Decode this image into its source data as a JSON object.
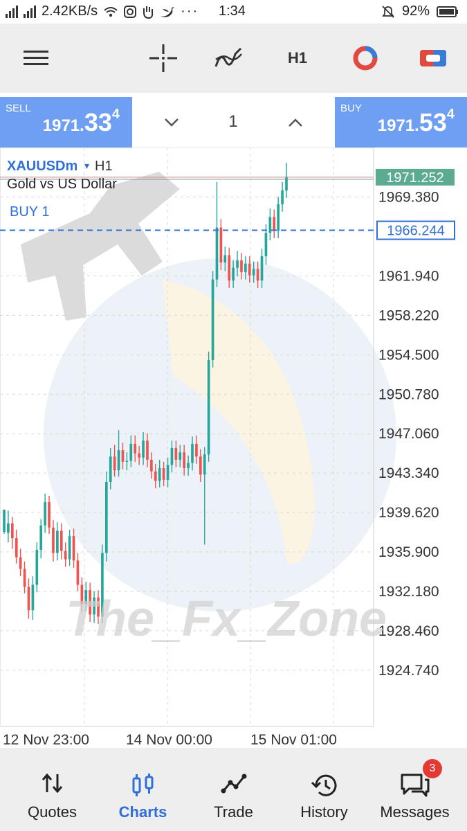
{
  "status_bar": {
    "speed": "2.42KB/s",
    "time": "1:34",
    "battery": "92%",
    "icons": [
      "signal-icon",
      "wifi-icon",
      "instagram-icon",
      "hand-icon",
      "twitter-icon",
      "more-dots-icon",
      "mute-icon",
      "battery-icon"
    ]
  },
  "toolbar": {
    "timeframe": "H1",
    "icons": [
      "menu-icon",
      "crosshair-icon",
      "indicators-icon",
      "objects-icon",
      "account-icon"
    ]
  },
  "trade_panel": {
    "sell_label": "SELL",
    "sell_price_small": "1971.",
    "sell_price_big": "33",
    "sell_price_sup": "4",
    "lot": "1",
    "buy_label": "BUY",
    "buy_price_small": "1971.",
    "buy_price_big": "53",
    "buy_price_sup": "4"
  },
  "chart": {
    "symbol": "XAUUSDm",
    "timeframe": "H1",
    "description": "Gold vs US Dollar",
    "order_label": "BUY 1",
    "current_price": "1971.252",
    "order_price": "1966.244",
    "watermark": "The_Fx_Zone",
    "colors": {
      "bull": "#26a69a",
      "bear": "#ef5350",
      "order_line": "#2f6fd6",
      "price_tag": "#26a69a"
    }
  },
  "chart_data": {
    "type": "candlestick",
    "y_ticks": [
      "1969.380",
      "1961.940",
      "1958.220",
      "1954.500",
      "1950.780",
      "1947.060",
      "1943.340",
      "1939.620",
      "1935.900",
      "1932.180",
      "1928.460",
      "1924.740"
    ],
    "x_ticks": [
      "12 Nov 23:00",
      "14 Nov 00:00",
      "15 Nov 01:00"
    ],
    "ylim": [
      1921.4,
      1973.4
    ],
    "candles": [
      [
        1937.8,
        1939.9,
        1939.0,
        1937.6
      ],
      [
        1937.7,
        1938.6,
        1939.8,
        1936.8
      ],
      [
        1938.6,
        1937.2,
        1939.2,
        1936.2
      ],
      [
        1937.2,
        1935.4,
        1938.0,
        1934.8
      ],
      [
        1935.4,
        1934.3,
        1936.2,
        1933.6
      ],
      [
        1934.3,
        1932.6,
        1935.0,
        1932.0
      ],
      [
        1932.6,
        1930.4,
        1933.4,
        1929.6
      ],
      [
        1930.4,
        1932.8,
        1933.6,
        1929.5
      ],
      [
        1932.8,
        1936.1,
        1936.8,
        1932.1
      ],
      [
        1936.1,
        1938.4,
        1939.0,
        1935.3
      ],
      [
        1938.4,
        1940.6,
        1941.4,
        1937.7
      ],
      [
        1940.6,
        1938.2,
        1941.2,
        1937.6
      ],
      [
        1938.2,
        1935.8,
        1938.9,
        1935.0
      ],
      [
        1935.8,
        1937.9,
        1938.7,
        1935.1
      ],
      [
        1937.9,
        1936.0,
        1938.6,
        1935.2
      ],
      [
        1936.0,
        1935.2,
        1936.8,
        1934.5
      ],
      [
        1935.2,
        1937.4,
        1938.0,
        1934.6
      ],
      [
        1937.4,
        1935.1,
        1938.1,
        1934.4
      ],
      [
        1935.1,
        1932.8,
        1935.8,
        1932.2
      ],
      [
        1932.8,
        1931.0,
        1933.5,
        1930.2
      ],
      [
        1931.0,
        1932.3,
        1933.1,
        1930.3
      ],
      [
        1932.3,
        1930.0,
        1933.0,
        1929.3
      ],
      [
        1930.0,
        1931.6,
        1932.2,
        1929.2
      ],
      [
        1931.6,
        1929.8,
        1932.3,
        1929.1
      ],
      [
        1929.8,
        1935.8,
        1936.6,
        1929.2
      ],
      [
        1935.8,
        1942.5,
        1943.5,
        1935.0
      ],
      [
        1942.5,
        1944.9,
        1945.7,
        1941.8
      ],
      [
        1944.9,
        1943.6,
        1946.0,
        1943.0
      ],
      [
        1943.6,
        1945.5,
        1947.4,
        1943.0
      ],
      [
        1945.5,
        1944.4,
        1946.2,
        1943.7
      ],
      [
        1944.4,
        1944.5,
        1945.3,
        1943.6
      ],
      [
        1944.5,
        1946.1,
        1946.9,
        1943.9
      ],
      [
        1946.1,
        1945.2,
        1946.9,
        1944.4
      ],
      [
        1945.2,
        1944.8,
        1945.9,
        1944.1
      ],
      [
        1944.8,
        1946.4,
        1947.2,
        1944.1
      ],
      [
        1946.4,
        1944.6,
        1947.1,
        1943.9
      ],
      [
        1944.6,
        1943.5,
        1945.3,
        1942.8
      ],
      [
        1943.5,
        1942.6,
        1944.2,
        1941.9
      ],
      [
        1942.6,
        1943.8,
        1944.6,
        1942.0
      ],
      [
        1943.8,
        1942.7,
        1944.4,
        1942.1
      ],
      [
        1942.7,
        1944.1,
        1944.8,
        1942.0
      ],
      [
        1944.1,
        1945.7,
        1946.4,
        1943.4
      ],
      [
        1945.7,
        1944.6,
        1946.4,
        1943.9
      ],
      [
        1944.6,
        1945.3,
        1946.0,
        1943.9
      ],
      [
        1945.3,
        1943.8,
        1946.0,
        1943.1
      ],
      [
        1943.8,
        1944.3,
        1945.0,
        1943.1
      ],
      [
        1944.3,
        1946.1,
        1946.8,
        1943.6
      ],
      [
        1946.1,
        1944.9,
        1946.9,
        1944.2
      ],
      [
        1944.9,
        1943.2,
        1945.6,
        1942.5
      ],
      [
        1943.2,
        1945.1,
        1945.8,
        1936.6
      ],
      [
        1945.1,
        1954.0,
        1954.8,
        1944.4
      ],
      [
        1954.0,
        1961.6,
        1962.4,
        1953.3
      ],
      [
        1961.6,
        1966.5,
        1970.8,
        1960.9
      ],
      [
        1966.5,
        1963.2,
        1967.3,
        1962.5
      ],
      [
        1963.2,
        1963.9,
        1964.7,
        1962.4
      ],
      [
        1963.9,
        1961.5,
        1964.6,
        1960.8
      ],
      [
        1961.5,
        1962.7,
        1963.4,
        1960.8
      ],
      [
        1962.7,
        1963.4,
        1964.3,
        1961.9
      ],
      [
        1963.4,
        1962.3,
        1964.1,
        1961.6
      ],
      [
        1962.3,
        1963.1,
        1963.8,
        1961.6
      ],
      [
        1963.1,
        1962.0,
        1963.8,
        1961.3
      ],
      [
        1962.0,
        1962.6,
        1963.3,
        1961.3
      ],
      [
        1962.6,
        1961.5,
        1963.3,
        1960.8
      ],
      [
        1961.5,
        1963.8,
        1964.5,
        1960.8
      ],
      [
        1963.8,
        1966.0,
        1966.8,
        1963.0
      ],
      [
        1966.0,
        1967.5,
        1968.3,
        1965.3
      ],
      [
        1967.5,
        1966.2,
        1968.2,
        1965.5
      ],
      [
        1966.2,
        1968.7,
        1969.4,
        1965.5
      ],
      [
        1968.7,
        1970.0,
        1970.8,
        1968.0
      ],
      [
        1970.0,
        1971.3,
        1972.6,
        1969.3
      ]
    ]
  },
  "bottom_nav": {
    "items": [
      {
        "label": "Quotes",
        "icon": "quotes-icon"
      },
      {
        "label": "Charts",
        "icon": "charts-icon"
      },
      {
        "label": "Trade",
        "icon": "trade-icon"
      },
      {
        "label": "History",
        "icon": "history-icon"
      },
      {
        "label": "Messages",
        "icon": "messages-icon"
      }
    ],
    "messages_badge": "3"
  }
}
